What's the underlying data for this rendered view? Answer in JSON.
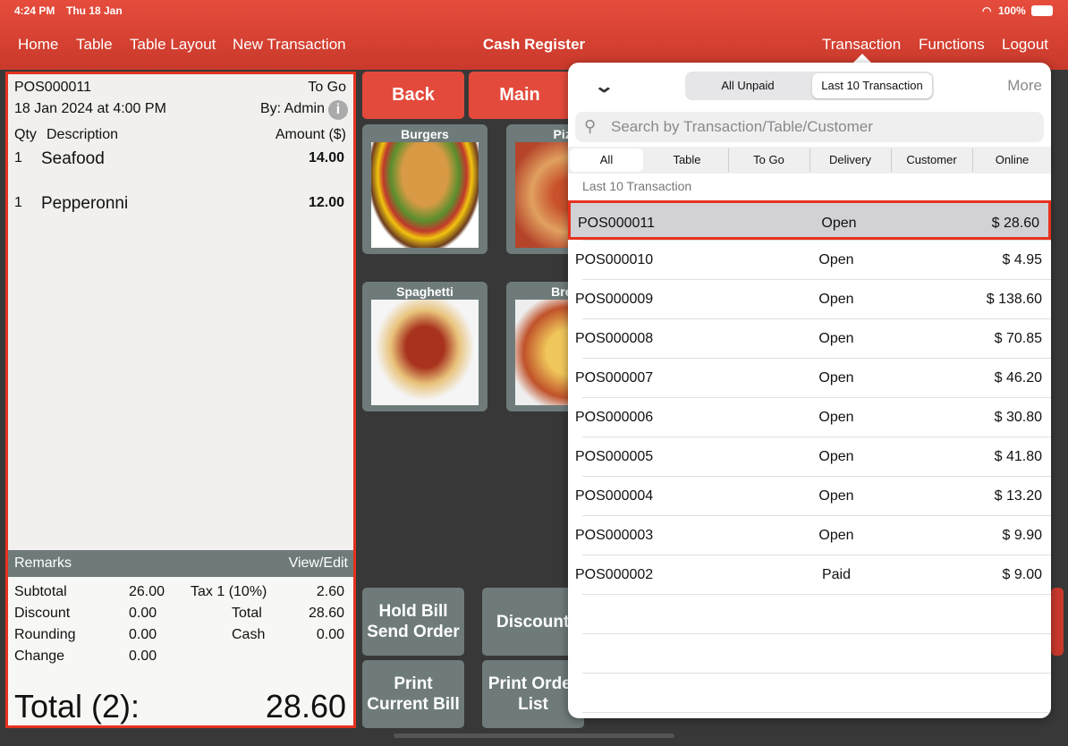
{
  "status": {
    "time": "4:24 PM",
    "date": "Thu 18 Jan",
    "battery": "100%"
  },
  "nav": {
    "left": [
      "Home",
      "Table",
      "Table Layout",
      "New Transaction"
    ],
    "title": "Cash Register",
    "right": [
      "Transaction",
      "Functions",
      "Logout"
    ]
  },
  "receipt": {
    "number": "POS000011",
    "type": "To Go",
    "datetime": "18 Jan 2024 at 4:00 PM",
    "by": "By: Admin",
    "headers": {
      "qty": "Qty",
      "desc": "Description",
      "amount": "Amount ($)"
    },
    "items": [
      {
        "qty": "1",
        "desc": "Seafood",
        "amount": "14.00"
      },
      {
        "qty": "1",
        "desc": "Pepperonni",
        "amount": "12.00"
      }
    ],
    "remarks": "Remarks",
    "view_edit": "View/Edit",
    "subtotal_label": "Subtotal",
    "subtotal": "26.00",
    "tax_label": "Tax 1 (10%)",
    "tax": "2.60",
    "discount_label": "Discount",
    "discount": "0.00",
    "total_label": "Total",
    "total": "28.60",
    "rounding_label": "Rounding",
    "rounding": "0.00",
    "cash_label": "Cash",
    "cash": "0.00",
    "change_label": "Change",
    "change": "0.00",
    "grand_label": "Total (2):",
    "grand": "28.60"
  },
  "menu": {
    "back": "Back",
    "main": "Main",
    "tiles": [
      "Burgers",
      "Pizza",
      "Spaghetti",
      "Bread"
    ]
  },
  "actions": {
    "hold": "Hold Bill Send Order",
    "discount": "Discount",
    "print_bill": "Print Current Bill",
    "print_order": "Print Order List"
  },
  "popover": {
    "segments": [
      "All Unpaid",
      "Last 10 Transaction"
    ],
    "more": "More",
    "search_placeholder": "Search by Transaction/Table/Customer",
    "filters": [
      "All",
      "Table",
      "To Go",
      "Delivery",
      "Customer",
      "Online"
    ],
    "section": "Last 10 Transaction",
    "rows": [
      {
        "id": "POS000011",
        "status": "Open",
        "amount": "$ 28.60"
      },
      {
        "id": "POS000010",
        "status": "Open",
        "amount": "$ 4.95"
      },
      {
        "id": "POS000009",
        "status": "Open",
        "amount": "$ 138.60"
      },
      {
        "id": "POS000008",
        "status": "Open",
        "amount": "$ 70.85"
      },
      {
        "id": "POS000007",
        "status": "Open",
        "amount": "$ 46.20"
      },
      {
        "id": "POS000006",
        "status": "Open",
        "amount": "$ 30.80"
      },
      {
        "id": "POS000005",
        "status": "Open",
        "amount": "$ 41.80"
      },
      {
        "id": "POS000004",
        "status": "Open",
        "amount": "$ 13.20"
      },
      {
        "id": "POS000003",
        "status": "Open",
        "amount": "$ 9.90"
      },
      {
        "id": "POS000002",
        "status": "Paid",
        "amount": "$ 9.00"
      }
    ]
  },
  "colors": {
    "brand": "#e34a3b",
    "highlight": "#e5321f",
    "panel": "#6e7b7a"
  }
}
